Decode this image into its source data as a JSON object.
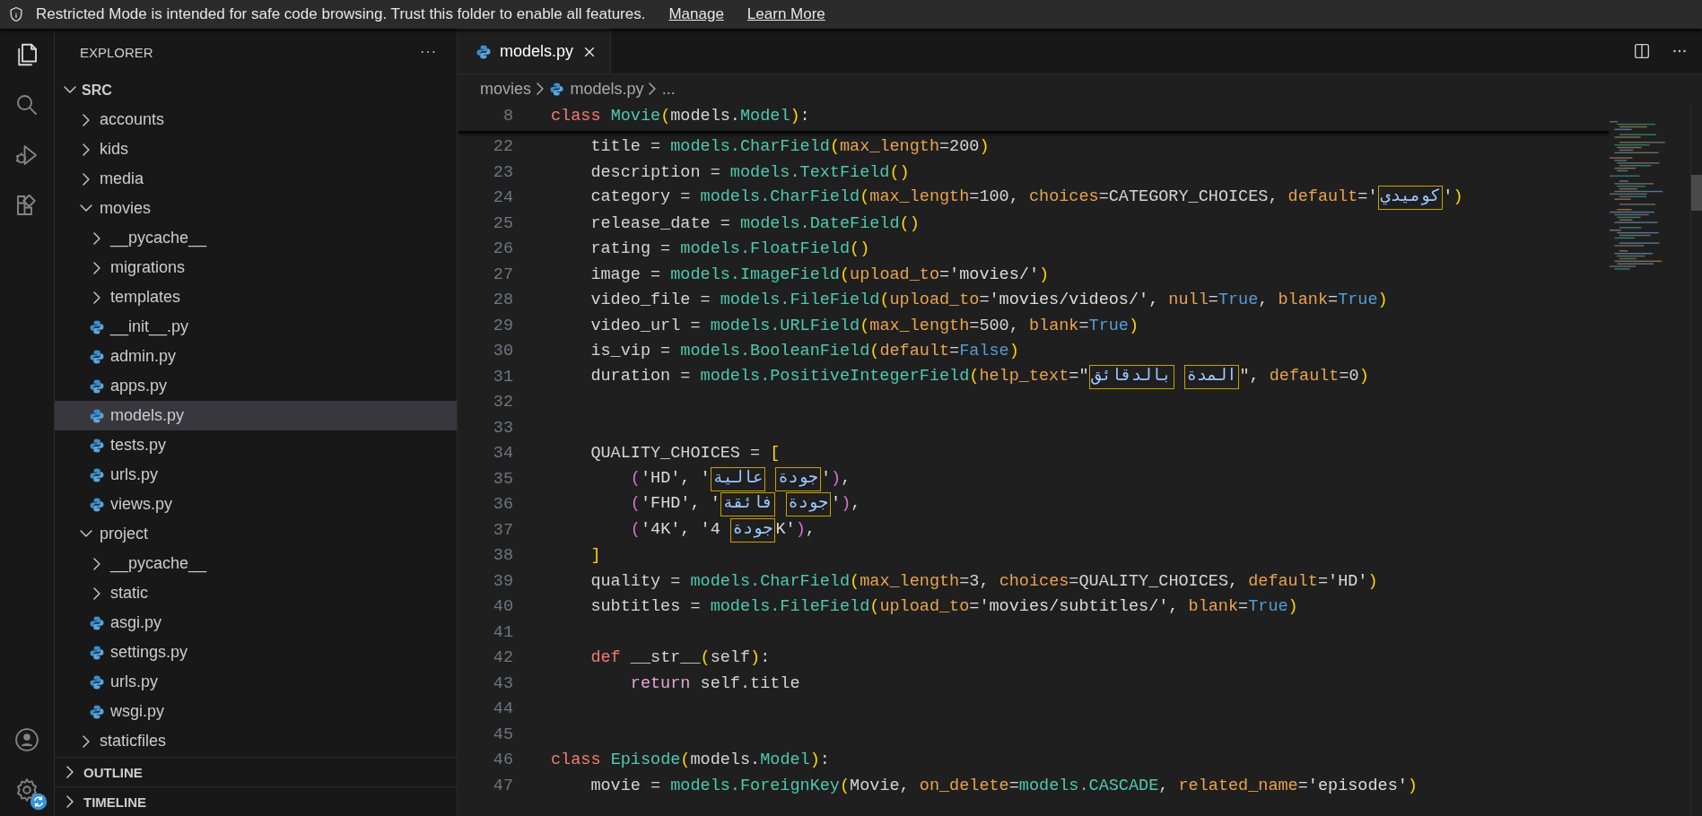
{
  "banner": {
    "message": "Restricted Mode is intended for safe code browsing. Trust this folder to enable all features.",
    "links": [
      "Manage",
      "Learn More"
    ]
  },
  "activity_bar": {
    "top": [
      {
        "kind": "files",
        "selected": true
      },
      {
        "kind": "search",
        "selected": false
      },
      {
        "kind": "debug",
        "selected": false
      },
      {
        "kind": "extensions",
        "selected": false
      }
    ],
    "bottom": [
      {
        "kind": "account"
      },
      {
        "kind": "settings"
      }
    ]
  },
  "sidebar": {
    "title": "EXPLORER",
    "more": "···",
    "root": {
      "label": "SRC",
      "expanded": true
    },
    "tree": [
      {
        "label": "accounts",
        "kind": "folder",
        "expanded": false,
        "selected": false
      },
      {
        "label": "kids",
        "kind": "folder",
        "expanded": false,
        "selected": false
      },
      {
        "label": "media",
        "kind": "folder",
        "expanded": false,
        "selected": false
      },
      {
        "label": "movies",
        "kind": "folder",
        "expanded": true,
        "selected": false,
        "children": [
          {
            "label": "__pycache__",
            "kind": "folder",
            "expanded": false,
            "selected": false
          },
          {
            "label": "migrations",
            "kind": "folder",
            "expanded": false,
            "selected": false
          },
          {
            "label": "templates",
            "kind": "folder",
            "expanded": false,
            "selected": false
          },
          {
            "label": "__init__.py",
            "kind": "file",
            "selected": false
          },
          {
            "label": "admin.py",
            "kind": "file",
            "selected": false
          },
          {
            "label": "apps.py",
            "kind": "file",
            "selected": false
          },
          {
            "label": "models.py",
            "kind": "file",
            "selected": true
          },
          {
            "label": "tests.py",
            "kind": "file",
            "selected": false
          },
          {
            "label": "urls.py",
            "kind": "file",
            "selected": false
          },
          {
            "label": "views.py",
            "kind": "file",
            "selected": false
          }
        ]
      },
      {
        "label": "project",
        "kind": "folder",
        "expanded": true,
        "selected": false,
        "children": [
          {
            "label": "__pycache__",
            "kind": "folder",
            "expanded": false,
            "selected": false
          },
          {
            "label": "static",
            "kind": "folder",
            "expanded": false,
            "selected": false
          },
          {
            "label": "asgi.py",
            "kind": "file",
            "selected": false
          },
          {
            "label": "settings.py",
            "kind": "file",
            "selected": false
          },
          {
            "label": "urls.py",
            "kind": "file",
            "selected": false
          },
          {
            "label": "wsgi.py",
            "kind": "file",
            "selected": false
          }
        ]
      },
      {
        "label": "staticfiles",
        "kind": "folder",
        "expanded": false,
        "selected": false
      }
    ],
    "panels": [
      {
        "label": "OUTLINE",
        "expanded": false
      },
      {
        "label": "TIMELINE",
        "expanded": false
      }
    ]
  },
  "tabs": [
    {
      "label": "models.py",
      "selected": true
    }
  ],
  "breadcrumb": [
    "movies",
    "models.py",
    "..."
  ],
  "sticky_line": {
    "number": "8",
    "tokens": [
      {
        "kind": "keyword",
        "text": "class "
      },
      {
        "kind": "type",
        "text": "Movie"
      },
      {
        "kind": "bracket1",
        "text": "("
      },
      {
        "kind": "plain",
        "text": "models."
      },
      {
        "kind": "type",
        "text": "Model"
      },
      {
        "kind": "bracket1",
        "text": ")"
      },
      {
        "kind": "plain",
        "text": ":"
      }
    ]
  },
  "code_lines": [
    {
      "number": "22",
      "tokens": [
        {
          "kind": "plain",
          "text": "    title = "
        },
        {
          "kind": "type",
          "text": "models.CharField"
        },
        {
          "kind": "bracket1",
          "text": "("
        },
        {
          "kind": "param",
          "text": "max_length"
        },
        {
          "kind": "plain",
          "text": "=200"
        },
        {
          "kind": "bracket1",
          "text": ")"
        }
      ]
    },
    {
      "number": "23",
      "tokens": [
        {
          "kind": "plain",
          "text": "    description = "
        },
        {
          "kind": "type",
          "text": "models.TextField"
        },
        {
          "kind": "bracket1",
          "text": "()"
        }
      ]
    },
    {
      "number": "24",
      "tokens": [
        {
          "kind": "plain",
          "text": "    category = "
        },
        {
          "kind": "type",
          "text": "models.CharField"
        },
        {
          "kind": "bracket1",
          "text": "("
        },
        {
          "kind": "param",
          "text": "max_length"
        },
        {
          "kind": "plain",
          "text": "=100, "
        },
        {
          "kind": "param",
          "text": "choices"
        },
        {
          "kind": "plain",
          "text": "=CATEGORY_CHOICES, "
        },
        {
          "kind": "param",
          "text": "default"
        },
        {
          "kind": "string",
          "text": "='"
        },
        {
          "kind": "unicode",
          "text": "كوميدي"
        },
        {
          "kind": "string",
          "text": "'"
        },
        {
          "kind": "bracket1",
          "text": ")"
        }
      ]
    },
    {
      "number": "25",
      "tokens": [
        {
          "kind": "plain",
          "text": "    release_date = "
        },
        {
          "kind": "type",
          "text": "models.DateField"
        },
        {
          "kind": "bracket1",
          "text": "()"
        }
      ]
    },
    {
      "number": "26",
      "tokens": [
        {
          "kind": "plain",
          "text": "    rating = "
        },
        {
          "kind": "type",
          "text": "models.FloatField"
        },
        {
          "kind": "bracket1",
          "text": "()"
        }
      ]
    },
    {
      "number": "27",
      "tokens": [
        {
          "kind": "plain",
          "text": "    image = "
        },
        {
          "kind": "type",
          "text": "models.ImageField"
        },
        {
          "kind": "bracket1",
          "text": "("
        },
        {
          "kind": "param",
          "text": "upload_to"
        },
        {
          "kind": "string",
          "text": "='movies/'"
        },
        {
          "kind": "bracket1",
          "text": ")"
        }
      ]
    },
    {
      "number": "28",
      "tokens": [
        {
          "kind": "plain",
          "text": "    video_file = "
        },
        {
          "kind": "type",
          "text": "models.FileField"
        },
        {
          "kind": "bracket1",
          "text": "("
        },
        {
          "kind": "param",
          "text": "upload_to"
        },
        {
          "kind": "string",
          "text": "='movies/videos/', "
        },
        {
          "kind": "param",
          "text": "null"
        },
        {
          "kind": "plain",
          "text": "="
        },
        {
          "kind": "constant",
          "text": "True"
        },
        {
          "kind": "plain",
          "text": ", "
        },
        {
          "kind": "param",
          "text": "blank"
        },
        {
          "kind": "plain",
          "text": "="
        },
        {
          "kind": "constant",
          "text": "True"
        },
        {
          "kind": "bracket1",
          "text": ")"
        }
      ]
    },
    {
      "number": "29",
      "tokens": [
        {
          "kind": "plain",
          "text": "    video_url = "
        },
        {
          "kind": "type",
          "text": "models.URLField"
        },
        {
          "kind": "bracket1",
          "text": "("
        },
        {
          "kind": "param",
          "text": "max_length"
        },
        {
          "kind": "plain",
          "text": "=500, "
        },
        {
          "kind": "param",
          "text": "blank"
        },
        {
          "kind": "plain",
          "text": "="
        },
        {
          "kind": "constant",
          "text": "True"
        },
        {
          "kind": "bracket1",
          "text": ")"
        }
      ]
    },
    {
      "number": "30",
      "tokens": [
        {
          "kind": "plain",
          "text": "    is_vip = "
        },
        {
          "kind": "type",
          "text": "models.BooleanField"
        },
        {
          "kind": "bracket1",
          "text": "("
        },
        {
          "kind": "param",
          "text": "default"
        },
        {
          "kind": "plain",
          "text": "="
        },
        {
          "kind": "constant",
          "text": "False"
        },
        {
          "kind": "bracket1",
          "text": ")"
        }
      ]
    },
    {
      "number": "31",
      "tokens": [
        {
          "kind": "plain",
          "text": "    duration = "
        },
        {
          "kind": "type",
          "text": "models.PositiveIntegerField"
        },
        {
          "kind": "bracket1",
          "text": "("
        },
        {
          "kind": "param",
          "text": "help_text"
        },
        {
          "kind": "string",
          "text": "=\""
        },
        {
          "kind": "unicode",
          "text": "بالدقائق"
        },
        {
          "kind": "unicode",
          "text": "المدة"
        },
        {
          "kind": "string",
          "text": "\", "
        },
        {
          "kind": "param",
          "text": "default"
        },
        {
          "kind": "plain",
          "text": "=0"
        },
        {
          "kind": "bracket1",
          "text": ")"
        }
      ]
    },
    {
      "number": "32"
    },
    {
      "number": "33"
    },
    {
      "number": "34",
      "tokens": [
        {
          "kind": "plain",
          "text": "    QUALITY_CHOICES = "
        },
        {
          "kind": "bracket1",
          "text": "["
        }
      ]
    },
    {
      "number": "35",
      "tokens": [
        {
          "kind": "bracket2",
          "text": "        ("
        },
        {
          "kind": "string",
          "text": "'HD', '"
        },
        {
          "kind": "unicode",
          "text": "عالية"
        },
        {
          "kind": "unicode",
          "text": "جودة"
        },
        {
          "kind": "string",
          "text": "'"
        },
        {
          "kind": "bracket2",
          "text": ")"
        },
        {
          "kind": "plain",
          "text": ","
        }
      ]
    },
    {
      "number": "36",
      "tokens": [
        {
          "kind": "bracket2",
          "text": "        ("
        },
        {
          "kind": "string",
          "text": "'FHD', '"
        },
        {
          "kind": "unicode",
          "text": "فائقة"
        },
        {
          "kind": "unicode",
          "text": "جودة"
        },
        {
          "kind": "string",
          "text": "'"
        },
        {
          "kind": "bracket2",
          "text": ")"
        },
        {
          "kind": "plain",
          "text": ","
        }
      ]
    },
    {
      "number": "37",
      "tokens": [
        {
          "kind": "bracket2",
          "text": "        ("
        },
        {
          "kind": "string",
          "text": "'4K', '4 "
        },
        {
          "kind": "unicode",
          "text": "جودة"
        },
        {
          "kind": "string",
          "text": "K'"
        },
        {
          "kind": "bracket2",
          "text": ")"
        },
        {
          "kind": "plain",
          "text": ","
        }
      ]
    },
    {
      "number": "38",
      "tokens": [
        {
          "kind": "bracket1",
          "text": "    ]"
        }
      ]
    },
    {
      "number": "39",
      "tokens": [
        {
          "kind": "plain",
          "text": "    quality = "
        },
        {
          "kind": "type",
          "text": "models.CharField"
        },
        {
          "kind": "bracket1",
          "text": "("
        },
        {
          "kind": "param",
          "text": "max_length"
        },
        {
          "kind": "plain",
          "text": "=3, "
        },
        {
          "kind": "param",
          "text": "choices"
        },
        {
          "kind": "plain",
          "text": "=QUALITY_CHOICES, "
        },
        {
          "kind": "param",
          "text": "default"
        },
        {
          "kind": "string",
          "text": "='HD'"
        },
        {
          "kind": "bracket1",
          "text": ")"
        }
      ]
    },
    {
      "number": "40",
      "tokens": [
        {
          "kind": "plain",
          "text": "    subtitles = "
        },
        {
          "kind": "type",
          "text": "models.FileField"
        },
        {
          "kind": "bracket1",
          "text": "("
        },
        {
          "kind": "param",
          "text": "upload_to"
        },
        {
          "kind": "string",
          "text": "='movies/subtitles/', "
        },
        {
          "kind": "param",
          "text": "blank"
        },
        {
          "kind": "plain",
          "text": "="
        },
        {
          "kind": "constant",
          "text": "True"
        },
        {
          "kind": "bracket1",
          "text": ")"
        }
      ]
    },
    {
      "number": "41"
    },
    {
      "number": "42",
      "tokens": [
        {
          "kind": "keyword",
          "text": "    def "
        },
        {
          "kind": "plain",
          "text": "__str__"
        },
        {
          "kind": "bracket1",
          "text": "("
        },
        {
          "kind": "plain",
          "text": "self"
        },
        {
          "kind": "bracket1",
          "text": ")"
        },
        {
          "kind": "plain",
          "text": ":"
        }
      ]
    },
    {
      "number": "43",
      "tokens": [
        {
          "kind": "control",
          "text": "        return "
        },
        {
          "kind": "plain",
          "text": "self.title"
        }
      ]
    },
    {
      "number": "44"
    },
    {
      "number": "45"
    },
    {
      "number": "46",
      "tokens": [
        {
          "kind": "keyword",
          "text": "class "
        },
        {
          "kind": "type",
          "text": "Episode"
        },
        {
          "kind": "bracket1",
          "text": "("
        },
        {
          "kind": "plain",
          "text": "models."
        },
        {
          "kind": "type",
          "text": "Model"
        },
        {
          "kind": "bracket1",
          "text": ")"
        },
        {
          "kind": "plain",
          "text": ":"
        }
      ]
    },
    {
      "number": "47",
      "tokens": [
        {
          "kind": "plain",
          "text": "    movie = "
        },
        {
          "kind": "type",
          "text": "models.ForeignKey"
        },
        {
          "kind": "bracket1",
          "text": "("
        },
        {
          "kind": "plain",
          "text": "Movie, "
        },
        {
          "kind": "param",
          "text": "on_delete"
        },
        {
          "kind": "plain",
          "text": "="
        },
        {
          "kind": "type",
          "text": "models.CASCADE"
        },
        {
          "kind": "plain",
          "text": ", "
        },
        {
          "kind": "param",
          "text": "related_name"
        },
        {
          "kind": "string",
          "text": "='episodes'"
        },
        {
          "kind": "bracket1",
          "text": ")"
        }
      ]
    }
  ]
}
